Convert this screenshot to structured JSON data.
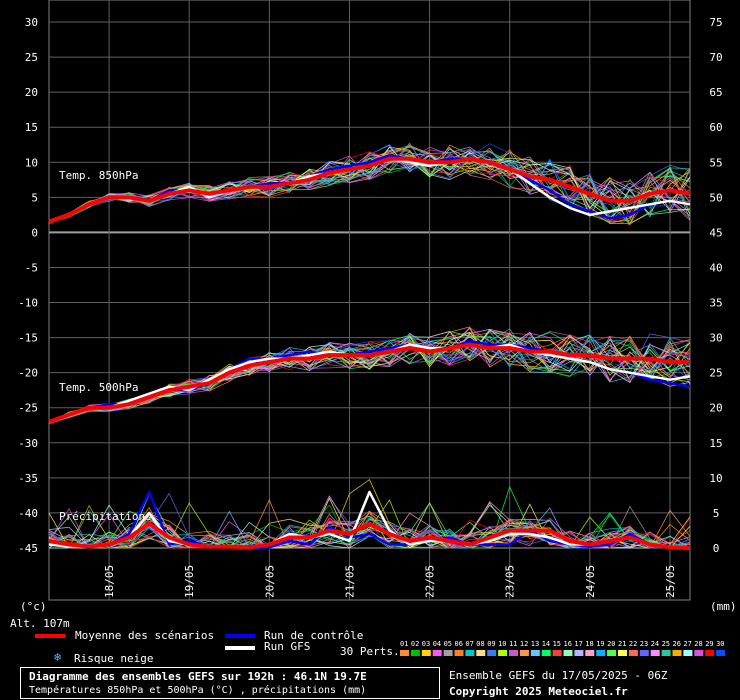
{
  "chart_data": {
    "type": "line",
    "title": "Diagramme des ensembles GEFS sur 192h : 46.1N 19.7E",
    "subtitle": "Températures 850hPa et 500hPa (°C) , précipitations (mm)",
    "y_left_label": "(°c)",
    "y_right_label": "(mm)",
    "altitude_label": "Alt. 107m",
    "ylim_left": [
      -45,
      30
    ],
    "ylim_right": [
      0,
      75
    ],
    "y_left_ticks": [
      30,
      25,
      20,
      15,
      10,
      5,
      0,
      -5,
      -10,
      -15,
      -20,
      -25,
      -30,
      -35,
      -40,
      -45
    ],
    "y_right_ticks": [
      75,
      70,
      65,
      60,
      55,
      50,
      45,
      40,
      35,
      30,
      25,
      20,
      15,
      10,
      5,
      0
    ],
    "x_ticks": [
      "18/05",
      "19/05",
      "20/05",
      "21/05",
      "22/05",
      "23/05",
      "24/05",
      "25/05"
    ],
    "annotations": [
      "Temp. 850hPa",
      "Temp. 500hPa",
      "Précipitations"
    ],
    "grid": true,
    "x_hours": [
      0,
      6,
      12,
      18,
      24,
      30,
      36,
      42,
      48,
      54,
      60,
      66,
      72,
      78,
      84,
      90,
      96,
      102,
      108,
      114,
      120,
      126,
      132,
      138,
      144,
      150,
      156,
      162,
      168,
      174,
      180,
      186,
      192
    ],
    "series": [
      {
        "name": "Moyenne des scénarios",
        "level": "850hPa",
        "color": "#ff0000",
        "values": [
          1.5,
          2.5,
          4,
          5,
          5,
          4.5,
          5.5,
          6,
          5.5,
          6,
          6.5,
          6.5,
          7,
          7.5,
          8.5,
          9,
          9.5,
          10.5,
          10.5,
          10,
          10,
          10.5,
          10,
          9,
          8,
          7.5,
          6.5,
          5.5,
          4.5,
          4.5,
          5.5,
          6,
          5.5
        ]
      },
      {
        "name": "Run de contrôle",
        "level": "850hPa",
        "color": "#0000ff",
        "values": [
          1.5,
          2.5,
          4,
          5,
          5,
          4.5,
          6,
          6,
          5.5,
          6,
          6.5,
          7,
          7,
          8,
          9,
          9.5,
          10,
          11,
          10.5,
          10,
          10.5,
          10.5,
          10,
          9,
          7.5,
          6,
          4,
          3,
          2,
          2.5,
          4,
          4.5,
          4
        ]
      },
      {
        "name": "Run GFS",
        "level": "850hPa",
        "color": "#ffffff",
        "values": [
          1.5,
          2.5,
          4,
          5,
          5,
          4.5,
          5.5,
          6.5,
          5,
          6,
          6.5,
          6.5,
          7,
          8,
          8.5,
          9,
          9.5,
          10.5,
          10,
          9.5,
          10,
          10.5,
          10,
          9,
          7,
          5,
          3.5,
          2.5,
          3,
          3.5,
          4,
          4.5,
          4
        ]
      },
      {
        "name": "Moyenne des scénarios",
        "level": "500hPa",
        "color": "#ff0000",
        "values": [
          -27,
          -26,
          -25,
          -25,
          -24.5,
          -23.5,
          -22.5,
          -22,
          -21.5,
          -20,
          -19,
          -18.5,
          -18,
          -18,
          -17.5,
          -17.5,
          -17.5,
          -17,
          -16.5,
          -17,
          -16.5,
          -16,
          -16.5,
          -16.5,
          -17,
          -17,
          -17.5,
          -17.5,
          -18,
          -18,
          -18,
          -18.5,
          -18.5
        ]
      },
      {
        "name": "Run de contrôle",
        "level": "500hPa",
        "color": "#0000ff",
        "values": [
          -27,
          -26,
          -25,
          -24.5,
          -24.5,
          -23,
          -22.5,
          -22.5,
          -21.5,
          -19.5,
          -18,
          -18,
          -17.5,
          -17,
          -17.5,
          -17.5,
          -17,
          -16.5,
          -16,
          -16.5,
          -16.5,
          -15.5,
          -16,
          -16,
          -16.5,
          -17,
          -18,
          -18.5,
          -19.5,
          -20,
          -21,
          -21.5,
          -22
        ]
      },
      {
        "name": "Run GFS",
        "level": "500hPa",
        "color": "#ffffff",
        "values": [
          -27,
          -26,
          -25,
          -25,
          -24,
          -23,
          -22,
          -22.5,
          -21,
          -19.5,
          -18.5,
          -18,
          -18,
          -17.5,
          -17,
          -17.5,
          -17.5,
          -17,
          -16,
          -16.5,
          -16.5,
          -16,
          -16.5,
          -16,
          -17,
          -17.5,
          -18,
          -18.5,
          -19.5,
          -20,
          -20.5,
          -21,
          -20.5
        ]
      },
      {
        "name": "Moyenne des scénarios",
        "level": "precip",
        "color": "#ff0000",
        "values": [
          1,
          0.5,
          0.2,
          0.5,
          1.5,
          3.5,
          1.5,
          0.5,
          0.2,
          0.2,
          0.1,
          0.5,
          1.5,
          1.5,
          2.5,
          2,
          3.5,
          2,
          1,
          1.5,
          1,
          0.5,
          1.5,
          2.5,
          2.5,
          2.5,
          1,
          0.5,
          1,
          1.5,
          0.5,
          0.1,
          0
        ]
      },
      {
        "name": "Run de contrôle",
        "level": "precip",
        "color": "#0000ff",
        "values": [
          0.5,
          0.3,
          0.1,
          0.5,
          2,
          8,
          0.5,
          1,
          0.2,
          0.1,
          0,
          0.1,
          1,
          0.5,
          3,
          1.5,
          2,
          0.5,
          0.5,
          1,
          1.5,
          0.5,
          0.5,
          0.5,
          2.5,
          1,
          0.5,
          0.2,
          0.5,
          2,
          0.5,
          0.2,
          0
        ]
      },
      {
        "name": "Run GFS",
        "level": "precip",
        "color": "#ffffff",
        "values": [
          0.5,
          0.2,
          0.1,
          0.5,
          1.5,
          5,
          1,
          0.5,
          0.2,
          0.2,
          0.1,
          0.5,
          2,
          1.5,
          2,
          1,
          8,
          2.5,
          0.5,
          1,
          1,
          0.5,
          1,
          2,
          2,
          1.5,
          0.5,
          0.5,
          1,
          1.5,
          0.5,
          0.2,
          0
        ]
      }
    ]
  },
  "legend": {
    "mean_label": "Moyenne des scénarios",
    "control_label": "Run de contrôle",
    "gfs_label": "Run GFS",
    "snow_label": "Risque neige",
    "perts_label": "30 Perts.",
    "pert_numbers": [
      "01",
      "02",
      "03",
      "04",
      "05",
      "06",
      "07",
      "08",
      "09",
      "10",
      "11",
      "12",
      "13",
      "14",
      "15",
      "16",
      "17",
      "18",
      "19",
      "20",
      "21",
      "22",
      "23",
      "24",
      "25",
      "26",
      "27",
      "28",
      "29",
      "30"
    ],
    "pert_colors": [
      "#ff8c3c",
      "#00c000",
      "#ffd400",
      "#ff55ff",
      "#a0a0a0",
      "#ff7f27",
      "#00c8c8",
      "#ffdc8c",
      "#3c78ff",
      "#b4ff00",
      "#c85ac8",
      "#ff9650",
      "#64c8ff",
      "#00ff64",
      "#ff3c3c",
      "#8cffb4",
      "#b4b4ff",
      "#ffa0c8",
      "#00b4ff",
      "#50ff50",
      "#ffff50",
      "#ff6464",
      "#6464ff",
      "#ff8cff",
      "#28c8a0",
      "#ffaa00",
      "#a0ffff",
      "#dc50dc",
      "#ff0000",
      "#0050ff"
    ]
  },
  "footer": {
    "title": "Diagramme des ensembles GEFS sur 192h : 46.1N 19.7E",
    "subtitle": "Températures 850hPa et 500hPa (°C) , précipitations (mm)",
    "run_info": "Ensemble GEFS du 17/05/2025 - 06Z",
    "copyright": "Copyright 2025 Meteociel.fr"
  }
}
